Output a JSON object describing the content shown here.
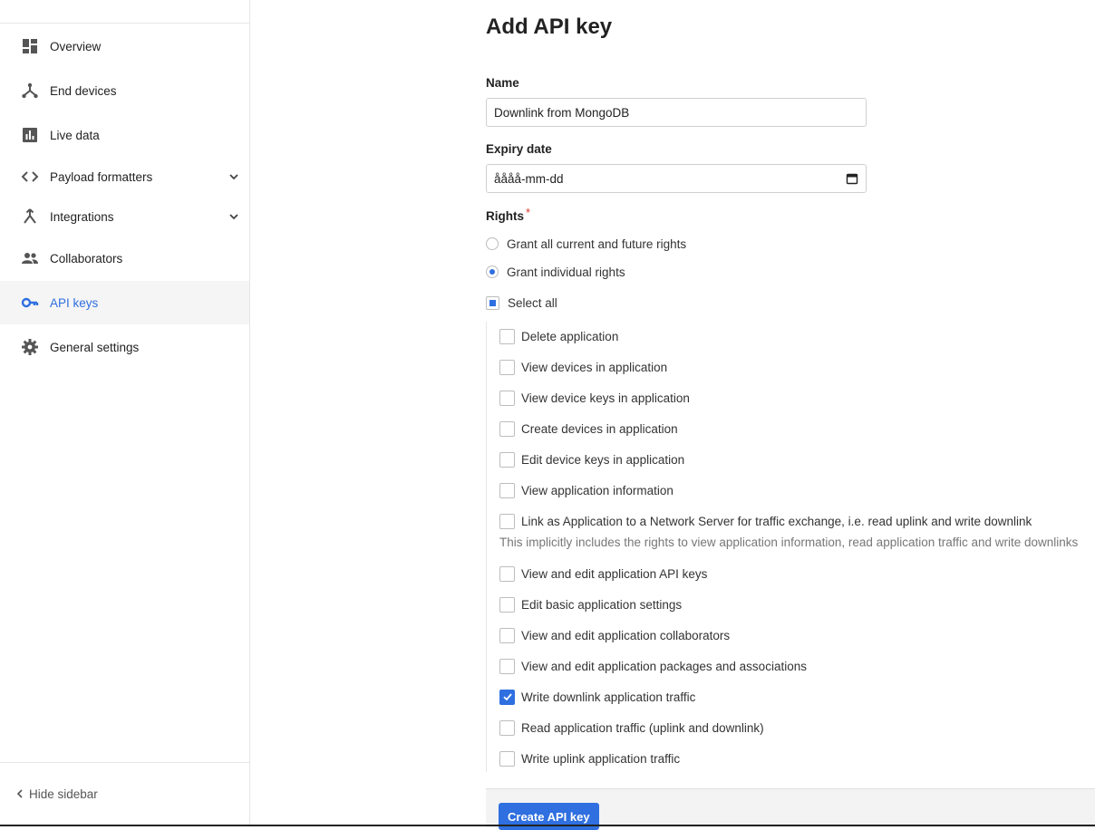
{
  "sidebar": {
    "items": [
      {
        "label": "Overview",
        "icon": "dashboard-icon",
        "active": false
      },
      {
        "label": "End devices",
        "icon": "device-hub-icon",
        "active": false
      },
      {
        "label": "Live data",
        "icon": "bar-chart-icon",
        "active": false
      },
      {
        "label": "Payload formatters",
        "icon": "code-icon",
        "active": false,
        "expandable": true
      },
      {
        "label": "Integrations",
        "icon": "merge-icon",
        "active": false,
        "expandable": true
      },
      {
        "label": "Collaborators",
        "icon": "people-icon",
        "active": false
      },
      {
        "label": "API keys",
        "icon": "key-icon",
        "active": true
      },
      {
        "label": "General settings",
        "icon": "gear-icon",
        "active": false
      }
    ],
    "hide_label": "Hide sidebar"
  },
  "form": {
    "title": "Add API key",
    "name_label": "Name",
    "name_value": "Downlink from MongoDB",
    "expiry_label": "Expiry date",
    "expiry_value": "åååå-mm-dd",
    "rights_label": "Rights",
    "rights_required": "*",
    "grant_all_label": "Grant all current and future rights",
    "grant_individual_label": "Grant individual rights",
    "select_all_label": "Select all",
    "rights": [
      {
        "label": "Delete application",
        "checked": false
      },
      {
        "label": "View devices in application",
        "checked": false
      },
      {
        "label": "View device keys in application",
        "checked": false
      },
      {
        "label": "Create devices in application",
        "checked": false
      },
      {
        "label": "Edit device keys in application",
        "checked": false
      },
      {
        "label": "View application information",
        "checked": false
      },
      {
        "label": "Link as Application to a Network Server for traffic exchange, i.e. read uplink and write downlink",
        "checked": false,
        "description": "This implicitly includes the rights to view application information, read application traffic and write downlinks"
      },
      {
        "label": "View and edit application API keys",
        "checked": false
      },
      {
        "label": "Edit basic application settings",
        "checked": false
      },
      {
        "label": "View and edit application collaborators",
        "checked": false
      },
      {
        "label": "View and edit application packages and associations",
        "checked": false
      },
      {
        "label": "Write downlink application traffic",
        "checked": true
      },
      {
        "label": "Read application traffic (uplink and downlink)",
        "checked": false
      },
      {
        "label": "Write uplink application traffic",
        "checked": false
      }
    ],
    "submit_label": "Create API key"
  },
  "colors": {
    "accent": "#2f6fe0",
    "required": "#d93a2b"
  }
}
